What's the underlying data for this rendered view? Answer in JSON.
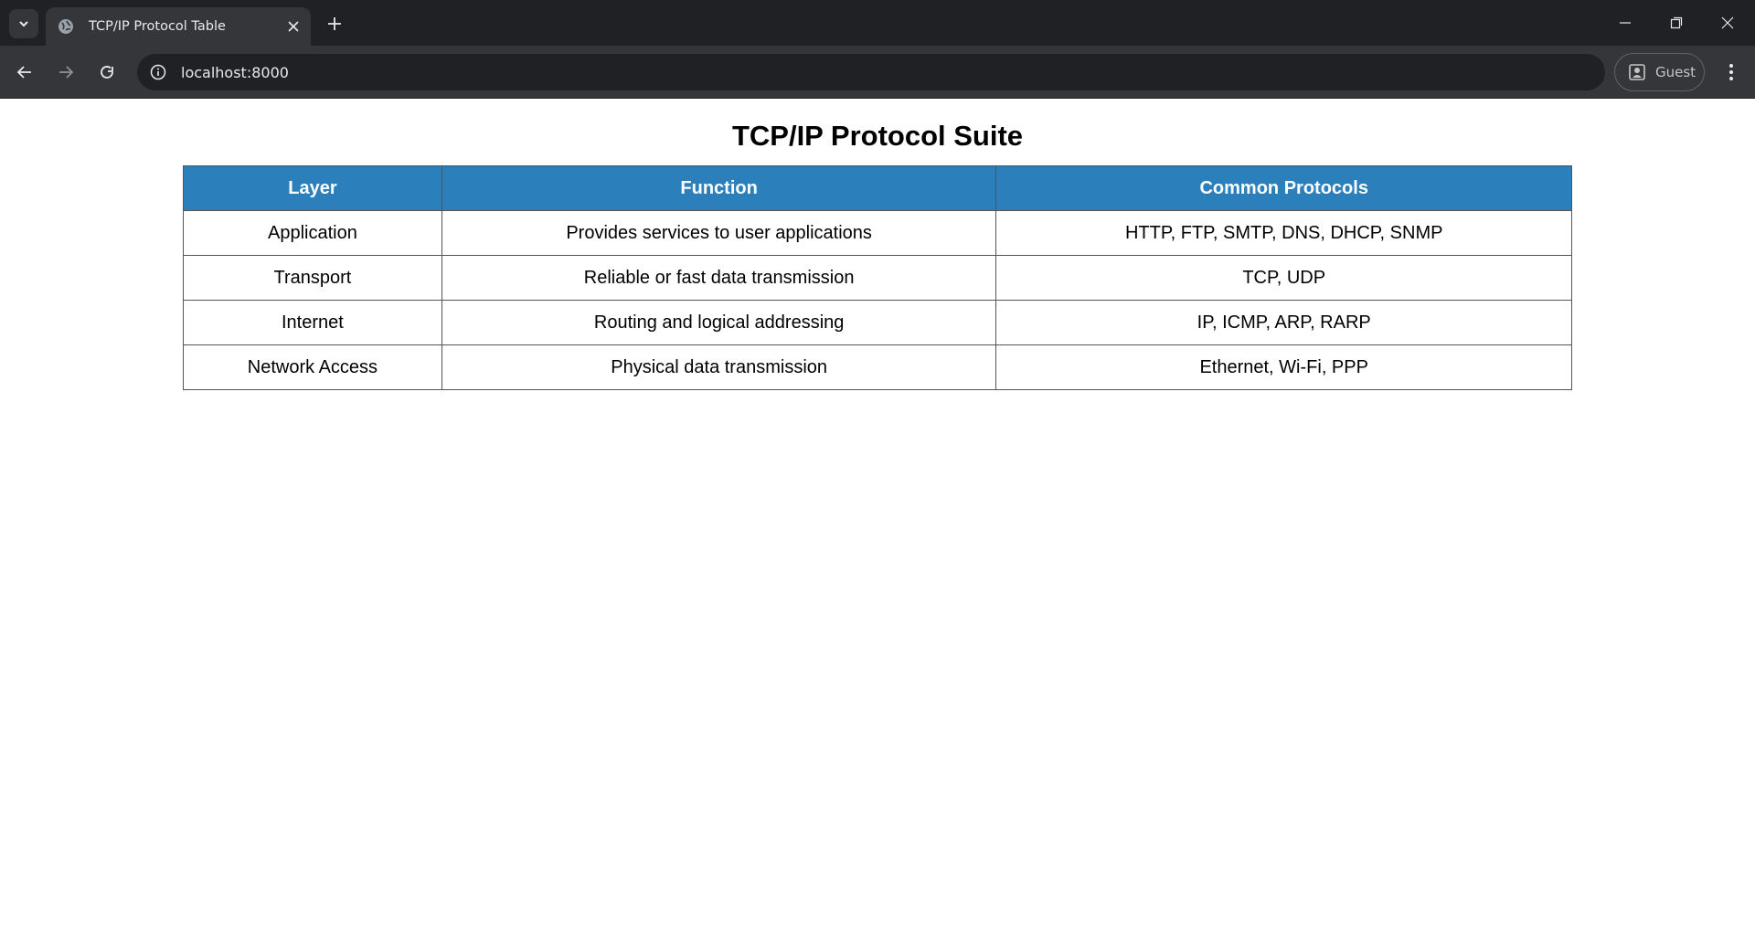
{
  "browser": {
    "tab_title": "TCP/IP Protocol Table",
    "url": "localhost:8000",
    "profile_label": "Guest",
    "icons": [
      "tab-search-icon",
      "globe-icon",
      "close-icon",
      "plus-icon",
      "minimize-icon",
      "restore-icon",
      "window-close-icon",
      "back-arrow-icon",
      "forward-arrow-icon",
      "reload-icon",
      "info-icon",
      "person-icon",
      "more-vert-icon"
    ]
  },
  "page": {
    "title": "TCP/IP Protocol Suite",
    "header_color": "#2b7fbb",
    "table": {
      "headers": [
        "Layer",
        "Function",
        "Common Protocols"
      ],
      "rows": [
        [
          "Application",
          "Provides services to user applications",
          "HTTP, FTP, SMTP, DNS, DHCP, SNMP"
        ],
        [
          "Transport",
          "Reliable or fast data transmission",
          "TCP, UDP"
        ],
        [
          "Internet",
          "Routing and logical addressing",
          "IP, ICMP, ARP, RARP"
        ],
        [
          "Network Access",
          "Physical data transmission",
          "Ethernet, Wi-Fi, PPP"
        ]
      ]
    }
  }
}
